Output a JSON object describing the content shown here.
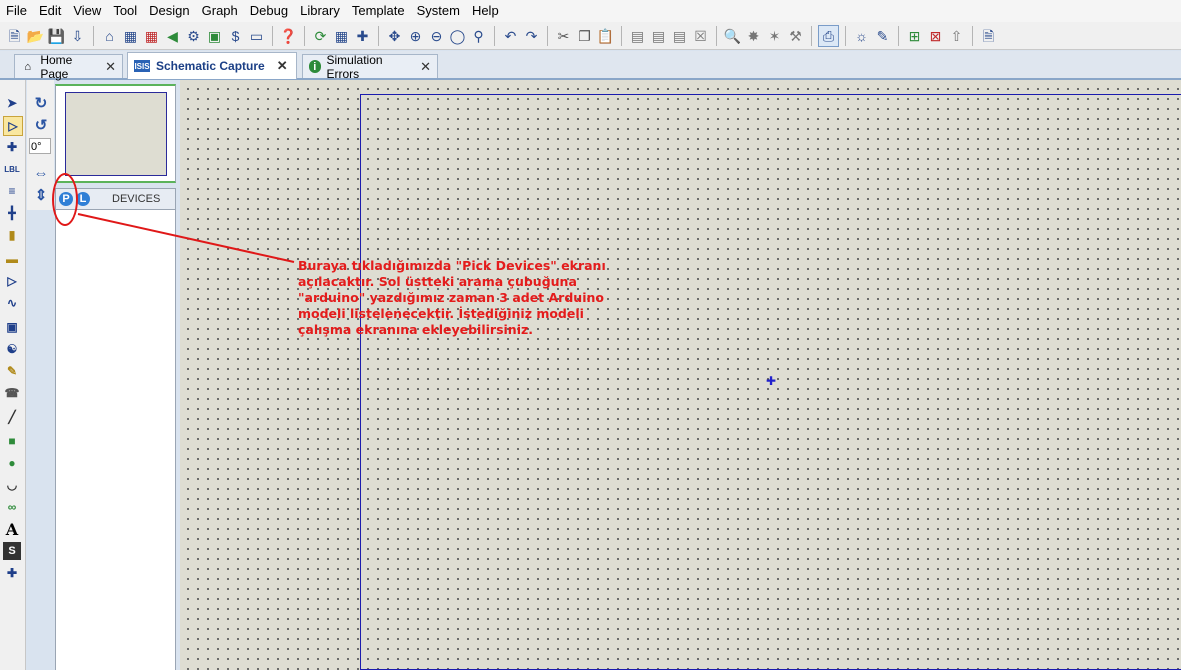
{
  "menu": [
    "File",
    "Edit",
    "View",
    "Tool",
    "Design",
    "Graph",
    "Debug",
    "Library",
    "Template",
    "System",
    "Help"
  ],
  "toolbar": {
    "groups": [
      [
        "new-file-icon",
        "open-folder-icon",
        "save-icon",
        "import-icon"
      ],
      [
        "home-icon",
        "isis-icon",
        "ares-icon",
        "back-icon",
        "bom-icon",
        "netlist-icon",
        "script-icon",
        "component-icon"
      ],
      [
        "help-icon"
      ],
      [
        "refresh-icon",
        "grid-icon",
        "origin-icon"
      ],
      [
        "pan-icon",
        "zoom-in-icon",
        "zoom-out-icon",
        "zoom-all-icon",
        "zoom-area-icon"
      ],
      [
        "undo-icon",
        "redo-icon"
      ],
      [
        "cut-icon",
        "copy-icon",
        "paste-icon"
      ],
      [
        "block-copy-icon",
        "block-move-icon",
        "block-rotate-icon",
        "block-delete-icon"
      ],
      [
        "pick-icon",
        "make-device-icon",
        "packaging-icon",
        "decompose-icon"
      ],
      [
        "wire-autoroute-icon"
      ],
      [
        "search-icon",
        "property-assign-icon"
      ],
      [
        "new-sheet-icon",
        "remove-sheet-icon",
        "exit-parent-icon"
      ],
      [
        "report-icon"
      ]
    ]
  },
  "tabs": [
    {
      "label": "Home Page",
      "icon": "home-icon",
      "active": false
    },
    {
      "label": "Schematic Capture",
      "icon": "isis-icon",
      "active": true
    },
    {
      "label": "Simulation Errors",
      "icon": "info-icon",
      "active": false
    }
  ],
  "left_tools": [
    "selection-mode-icon",
    "component-mode-icon",
    "junction-icon",
    "wire-label-icon",
    "text-script-icon",
    "bus-icon",
    "subcircuit-icon",
    "terminal-icon",
    "device-pin-icon",
    "graph-icon",
    "tape-recorder-icon",
    "generator-icon",
    "voltage-probe-icon",
    "virtual-instrument-icon",
    "line-icon",
    "box-icon",
    "circle-icon",
    "arc-icon",
    "closed-path-icon",
    "text-icon",
    "symbol-icon",
    "marker-icon"
  ],
  "rotation": {
    "angle": "0°"
  },
  "devices": {
    "p_label": "P",
    "l_label": "L",
    "title": "DEVICES"
  },
  "annotation": {
    "lines": [
      "Buraya tıkladığımızda \"Pick Devices\" ekranı",
      "açılacaktır. Sol üstteki arama çubuğuna",
      "\"arduino\" yazdığımız zaman 3 adet Arduino",
      "modeli listelenecektir. İstediğiniz modeli",
      "çalışma ekranına ekleyebilirsiniz."
    ],
    "color": "#e41c1c"
  }
}
